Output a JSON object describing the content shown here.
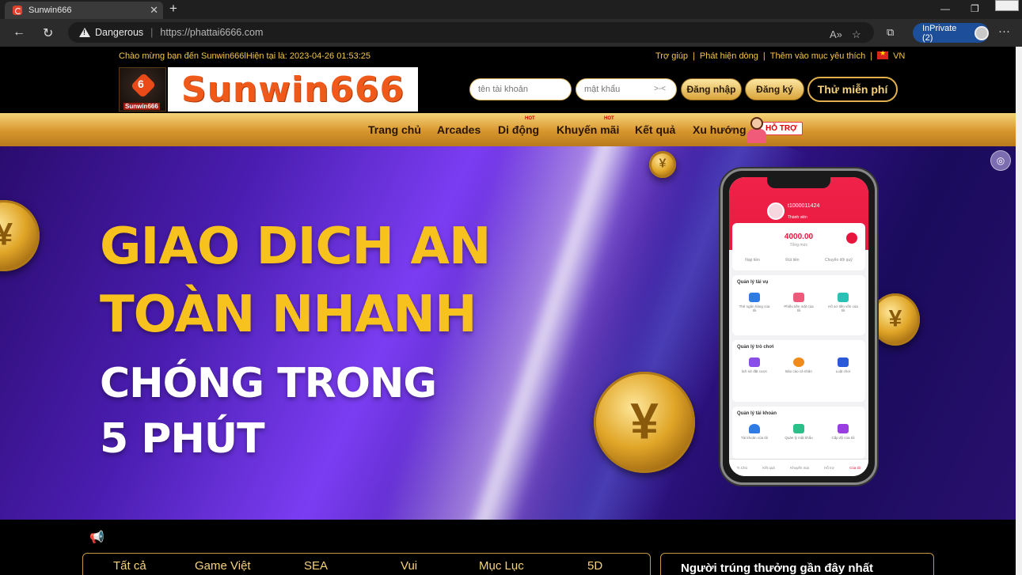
{
  "browser": {
    "tab_title": "Sunwin666",
    "tab_close": "✕",
    "new_tab": "+",
    "security_label": "Dangerous",
    "url": "https://phattai6666.com",
    "inprivate_label": "InPrivate (2)",
    "more_label": "···",
    "minimize": "—",
    "maximize": "❐"
  },
  "infobar": {
    "welcome": "Chào mừng bạn đến Sunwin666lHiện tại là: 2023-04-26 01:53:25",
    "links": [
      "Trợ giúp",
      "Phát hiện dòng",
      "Thêm vào mục yêu thích"
    ],
    "language": "VN"
  },
  "header": {
    "logo_text": "Sunwin666",
    "badge_number": "6",
    "badge_name": "Sunwin666",
    "username_placeholder": "tên tài khoản",
    "password_placeholder": "mật khẩu",
    "login_label": "Đăng nhập",
    "register_label": "Đăng ký",
    "trial_label": "Thử miễn phí"
  },
  "menu": {
    "items": [
      "Trang chủ",
      "Arcades",
      "Di động",
      "Khuyến mãi",
      "Kết quả",
      "Xu hướng"
    ],
    "hot_tag": "HOT",
    "support_label": "HỖ TRỢ"
  },
  "banner": {
    "line1": "GIAO DICH AN",
    "line2": "TOÀN NHANH",
    "line3": "CHÓNG TRONG",
    "line4": "5 PHÚT",
    "coin_symbol": "¥"
  },
  "phone": {
    "user_id": "t1000011424",
    "member_label": "Thành viên",
    "balance": "4000.00",
    "balance_label": "Tổng mức",
    "actions": [
      "Nạp tiền",
      "Rút tiền",
      "Chuyển đổi quỹ"
    ],
    "section1_title": "Quản lý tài vụ",
    "section1_items": [
      "Thẻ ngân hàng của tôi",
      "Phiếu tiền mặt của tôi",
      "Hồ sơ tiền vốn của tôi"
    ],
    "section2_title": "Quản lý trò chơi",
    "section2_items": [
      "lịch sử đặt cược",
      "Báo cáo cá nhân",
      "Luật chơi"
    ],
    "section3_title": "Quản lý tài khoản",
    "section3_items": [
      "Tài khoản của tôi",
      "Quản lý mật khẩu",
      "Cấp độ của tôi"
    ],
    "tabbar": [
      "Tr.Chủ",
      "Kết quả",
      "Khuyến mại",
      "Hỗ trợ",
      "Của tôi"
    ]
  },
  "games": {
    "tabs": [
      "Tất cả",
      "Game Việt",
      "SEA",
      "Vui",
      "Mục Lục",
      "5D"
    ],
    "winners_title": "Người trúng thưởng gần đây nhất"
  },
  "colors": {
    "gold": "#f7c21d",
    "menu_gold": "#d7962c",
    "phone_red": "#e8163e",
    "inprivate_blue": "#1d4e9a"
  }
}
